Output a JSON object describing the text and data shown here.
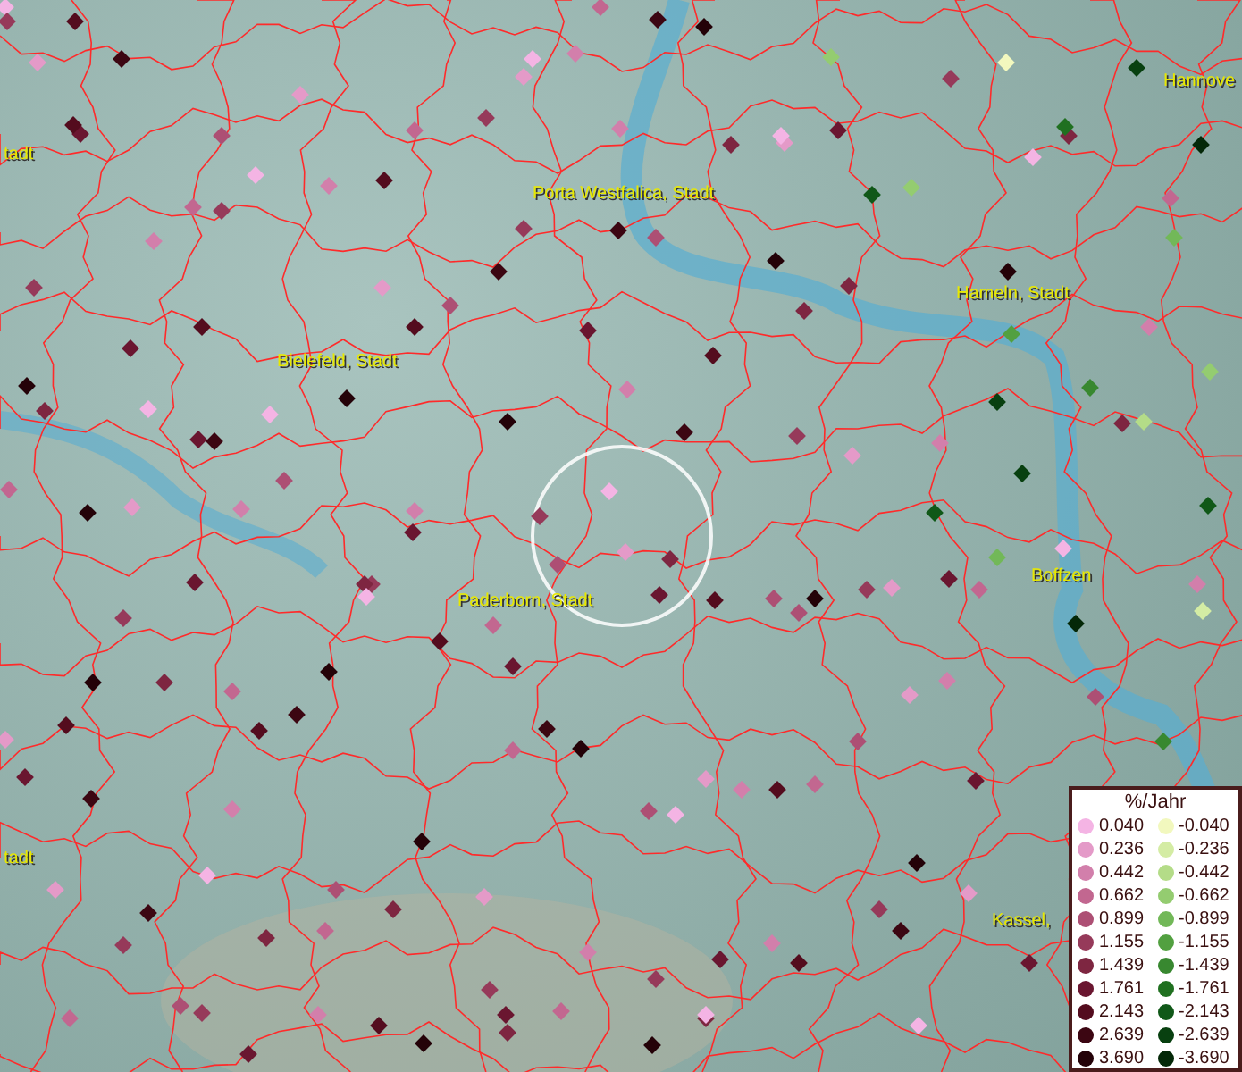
{
  "places": [
    {
      "name": "Hannove"
    },
    {
      "name": "tadt"
    },
    {
      "name": "Porta Westfalica, Stadt"
    },
    {
      "name": "Hameln, Stadt"
    },
    {
      "name": "Bielefeld, Stadt"
    },
    {
      "name": "Paderborn, Stadt"
    },
    {
      "name": "Boffzen"
    },
    {
      "name": "tadt"
    },
    {
      "name": "Kassel,"
    }
  ],
  "legend": {
    "title": "%/Jahr",
    "positive": [
      {
        "label": "0.040",
        "color": "#f4b4e4"
      },
      {
        "label": "0.236",
        "color": "#e49ac8"
      },
      {
        "label": "0.442",
        "color": "#d27fab"
      },
      {
        "label": "0.662",
        "color": "#c26790"
      },
      {
        "label": "0.899",
        "color": "#ad4f74"
      },
      {
        "label": "1.155",
        "color": "#963a5a"
      },
      {
        "label": "1.439",
        "color": "#7e2641"
      },
      {
        "label": "1.761",
        "color": "#6a1630"
      },
      {
        "label": "2.143",
        "color": "#540c1e"
      },
      {
        "label": "2.639",
        "color": "#3c0612"
      },
      {
        "label": "3.690",
        "color": "#240208"
      }
    ],
    "negative": [
      {
        "label": "-0.040",
        "color": "#f2f8be"
      },
      {
        "label": "-0.236",
        "color": "#d4eca4"
      },
      {
        "label": "-0.442",
        "color": "#b4dc88"
      },
      {
        "label": "-0.662",
        "color": "#94cc70"
      },
      {
        "label": "-0.899",
        "color": "#72b858"
      },
      {
        "label": "-1.155",
        "color": "#52a040"
      },
      {
        "label": "-1.439",
        "color": "#388830"
      },
      {
        "label": "-1.761",
        "color": "#207020"
      },
      {
        "label": "-2.143",
        "color": "#105818"
      },
      {
        "label": "-2.639",
        "color": "#084010"
      },
      {
        "label": "-3.690",
        "color": "#042808"
      }
    ]
  }
}
